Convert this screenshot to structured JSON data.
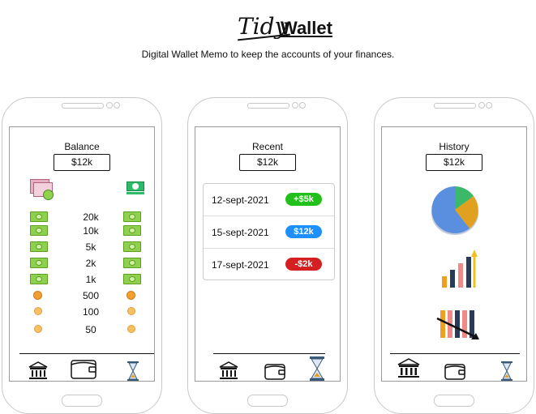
{
  "header": {
    "brand_script": "Tidy",
    "brand_main": "Wallet",
    "tagline": "Digital Wallet Memo to keep the accounts of your finances."
  },
  "balance_screen": {
    "title": "Balance",
    "amount": "$12k",
    "denominations": [
      "20k",
      "10k",
      "5k",
      "2k",
      "1k",
      "500",
      "100",
      "50"
    ]
  },
  "recent_screen": {
    "title": "Recent",
    "amount": "$12k",
    "transactions": [
      {
        "date": "12-sept-2021",
        "amount": "+$5k",
        "color": "#22c01a"
      },
      {
        "date": "15-sept-2021",
        "amount": "$12k",
        "color": "#1e8fff"
      },
      {
        "date": "17-sept-2021",
        "amount": "-$2k",
        "color": "#d42020"
      }
    ]
  },
  "history_screen": {
    "title": "History",
    "amount": "$12k"
  },
  "colors": {
    "bill_green": "#8fd14f",
    "coin_orange": "#f0a030",
    "pie_blue": "#5a8fe0",
    "pie_orange": "#e0a020",
    "pie_green": "#3cb86a"
  },
  "icons": {
    "nav": [
      "bank-icon",
      "wallet-icon",
      "hourglass-icon"
    ],
    "history": [
      "pie-chart-icon",
      "rising-bar-chart-icon",
      "falling-bar-chart-icon"
    ]
  }
}
